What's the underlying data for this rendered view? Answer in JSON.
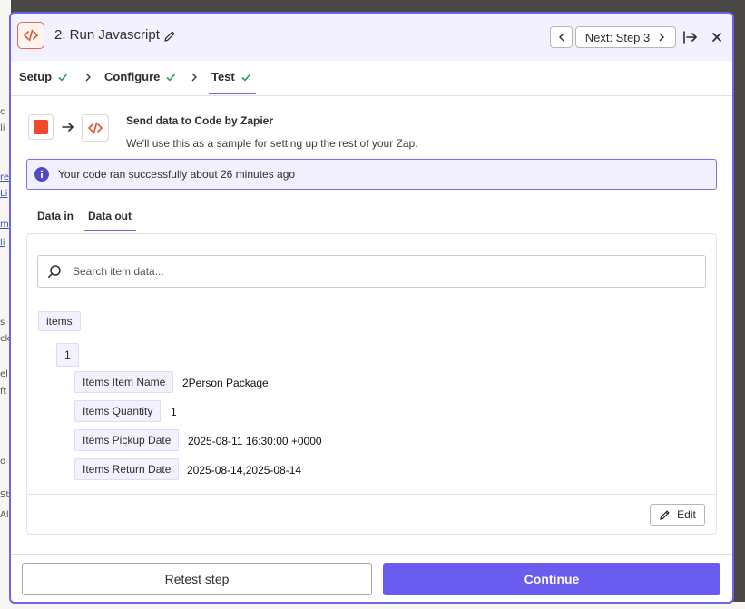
{
  "background": {
    "fragments": [
      "c",
      "li",
      "re",
      "Li",
      "m",
      "li",
      "s",
      "ck",
      "el",
      "ft",
      "o",
      "St",
      "Al"
    ]
  },
  "header": {
    "title": "2. Run Javascript",
    "next_label": "Next: Step 3",
    "icons": {
      "app": "code-icon",
      "edit": "pencil-icon",
      "prev": "chevron-left-icon",
      "next": "chevron-right-icon",
      "expand": "expand-panel-icon",
      "close": "close-icon"
    }
  },
  "steps": [
    {
      "label": "Setup",
      "status": "complete"
    },
    {
      "label": "Configure",
      "status": "complete"
    },
    {
      "label": "Test",
      "status": "complete",
      "active": true
    }
  ],
  "flow": {
    "title": "Send data to Code by Zapier",
    "subtitle": "We'll use this as a sample for setting up the rest of your Zap."
  },
  "info": {
    "message": "Your code ran successfully about 26 minutes ago"
  },
  "data_tabs": {
    "data_in": "Data in",
    "data_out": "Data out",
    "active": "Data out"
  },
  "search": {
    "placeholder": "Search item data..."
  },
  "tree": {
    "root_key": "items",
    "index_key": "1",
    "fields": [
      {
        "key": "Items Item Name",
        "value": "2Person Package"
      },
      {
        "key": "Items Quantity",
        "value": "1"
      },
      {
        "key": "Items Pickup Date",
        "value": "2025-08-11 16:30:00 +0000"
      },
      {
        "key": "Items Return Date",
        "value": "2025-08-14,2025-08-14"
      }
    ]
  },
  "edit_label": "Edit",
  "footer": {
    "retest_label": "Retest step",
    "continue_label": "Continue"
  },
  "colors": {
    "accent": "#6b5cf0",
    "success": "#2f9e5a",
    "brand_orange": "#e0532b"
  }
}
